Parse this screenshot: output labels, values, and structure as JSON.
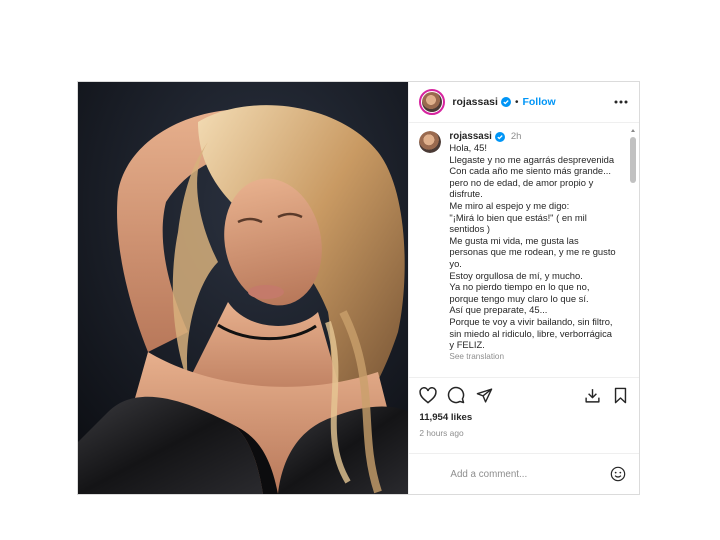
{
  "post": {
    "username": "rojassasi",
    "follow_label": "Follow",
    "separator": "•",
    "photo_alt": "",
    "caption": {
      "username": "rojassasi",
      "time": "2h",
      "lines": [
        "Hola, 45!",
        "Llegaste y no me agarrás desprevenida",
        "Con cada año me siento más grande...",
        "pero no de edad, de amor propio y",
        "disfrute.",
        "Me miro al espejo y me digo:",
        "\"¡Mirá lo bien que estás!\" ( en mil",
        "sentidos )",
        "Me gusta mi vida, me gusta las",
        "personas que me rodean, y me re gusto",
        "yo.",
        "Estoy orgullosa de mí, y mucho.",
        "Ya no pierdo tiempo en lo que no,",
        "porque tengo muy claro lo que sí.",
        "Así que preparate, 45...",
        "Porque te voy a vivir bailando, sin filtro,",
        "sin miedo al ridiculo, libre, verborrágica",
        "y FELIZ."
      ],
      "see_translation": "See translation"
    },
    "likes": "11,954 likes",
    "posted_ago": "2 hours ago",
    "comment_placeholder": "Add a comment..."
  },
  "icons": {
    "verified": "verified-badge-icon",
    "more": "more-options-icon",
    "like": "heart-icon",
    "comment": "comment-bubble-icon",
    "share": "paper-plane-icon",
    "download": "download-icon",
    "save": "bookmark-icon",
    "emoji": "emoji-smile-icon"
  },
  "colors": {
    "accent": "#0095f6",
    "verified": "#0095f6",
    "muted_text": "#8e8e8e",
    "border": "#dbdbdb"
  }
}
